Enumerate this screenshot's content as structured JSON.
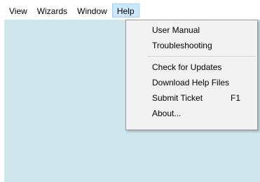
{
  "menubar": {
    "items": [
      {
        "label": "View"
      },
      {
        "label": "Wizards"
      },
      {
        "label": "Window"
      },
      {
        "label": "Help"
      }
    ],
    "active": "Help"
  },
  "help_menu": {
    "group1": [
      {
        "label": "User Manual"
      },
      {
        "label": "Troubleshooting"
      }
    ],
    "group2": [
      {
        "label": "Check for Updates"
      },
      {
        "label": "Download Help Files"
      },
      {
        "label": "Submit Ticket",
        "shortcut": "F1"
      },
      {
        "label": "About..."
      }
    ]
  },
  "colors": {
    "workspace": "#cfe6ec",
    "menu_background": "#f2f2f2",
    "active_highlight": "#cce8ff"
  }
}
